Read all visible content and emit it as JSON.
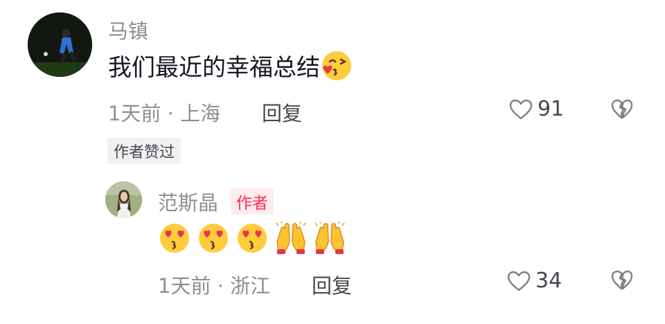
{
  "comment": {
    "username": "马镇",
    "text": "我们最近的幸福总结",
    "text_emoji": "kissing-face-with-closed-eyes-icon",
    "time_location": "1天前 · 上海",
    "reply_label": "回复",
    "like_count": "91",
    "liked_by_author_label": "作者赞过"
  },
  "reply": {
    "username": "范斯晶",
    "author_badge": "作者",
    "emojis": [
      "smiling-face-with-heart-eyes-icon",
      "smiling-face-with-heart-eyes-icon",
      "smiling-face-with-heart-eyes-icon",
      "raising-hands-icon",
      "raising-hands-icon"
    ],
    "time_location": "1天前 · 浙江",
    "reply_label": "回复",
    "like_count": "34"
  },
  "colors": {
    "accent": "#fe2c55",
    "muted_text": "#8e8e93",
    "primary_text": "#161823"
  }
}
